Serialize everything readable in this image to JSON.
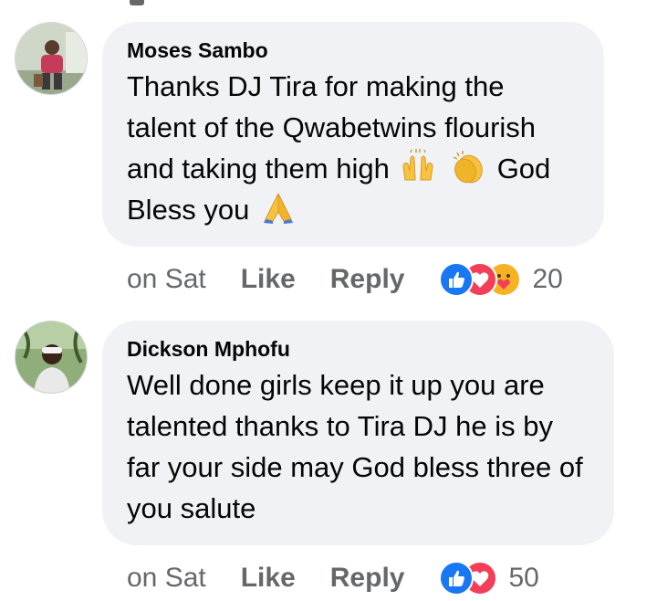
{
  "comments": [
    {
      "author": "Moses Sambo",
      "text_part1": "Thanks DJ Tira for making the talent of the Qwabetwins flourish and taking them high",
      "text_part2": "God",
      "text_part3": "Bless you",
      "time": "on Sat",
      "like_label": "Like",
      "reply_label": "Reply",
      "reactions": [
        "like-reaction",
        "love-reaction",
        "care-reaction"
      ],
      "reaction_count": "20",
      "emojis": [
        "raising-hands-emoji",
        "clapping-hands-emoji",
        "folded-hands-emoji"
      ]
    },
    {
      "author": "Dickson Mphofu",
      "text": "Well done girls keep it up you are talented thanks to Tira DJ he is by far your side may God bless three of you salute",
      "time": "on Sat",
      "like_label": "Like",
      "reply_label": "Reply",
      "reactions": [
        "like-reaction",
        "love-reaction"
      ],
      "reaction_count": "50"
    }
  ],
  "colors": {
    "bubble": "#f0f2f5",
    "meta_text": "#65676b",
    "like_blue": "#1877f2",
    "love_red": "#f33e58",
    "care_yellow": "#f7b125"
  }
}
